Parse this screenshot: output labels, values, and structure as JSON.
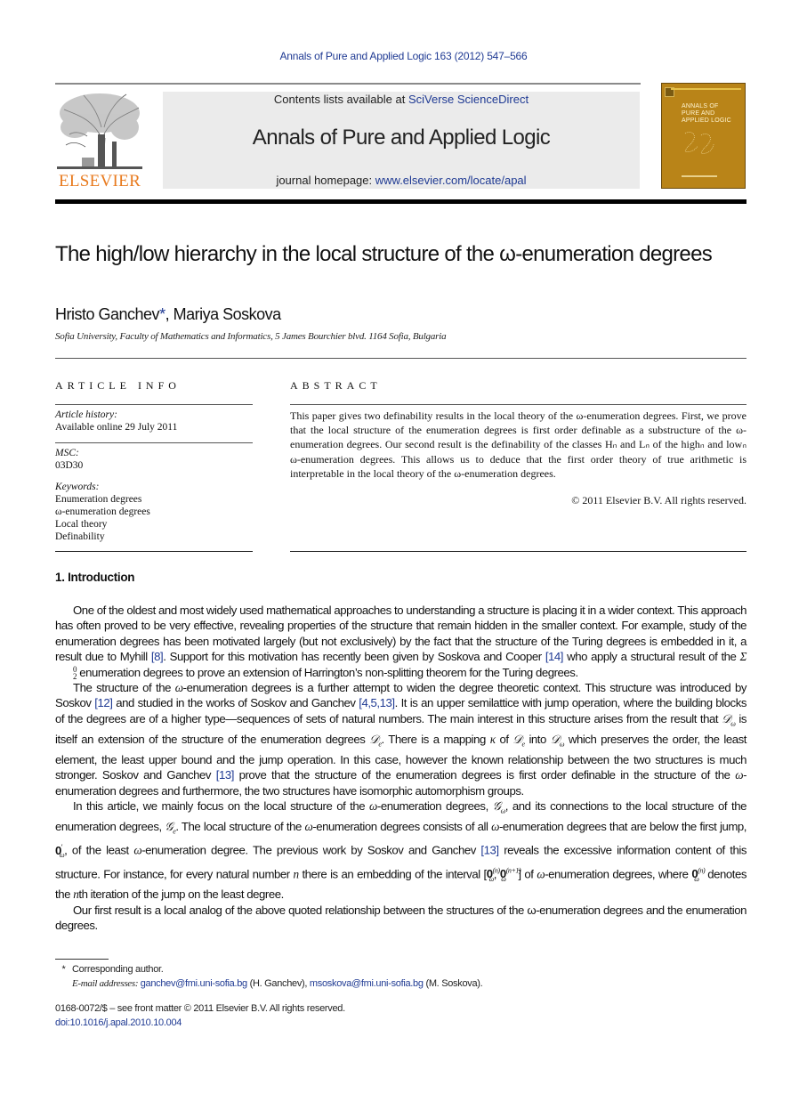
{
  "header": {
    "journal_ref": "Annals of Pure and Applied Logic 163 (2012) 547–566",
    "contents_prefix": "Contents lists available at ",
    "contents_link": "SciVerse ScienceDirect",
    "journal_title": "Annals of Pure and Applied Logic",
    "homepage_prefix": "journal homepage: ",
    "homepage_link": "www.elsevier.com/locate/apal",
    "publisher_logo": "ELSEVIER",
    "cover_title_lines": [
      "ANNALS OF",
      "PURE AND",
      "APPLIED LOGIC"
    ]
  },
  "article": {
    "title": "The high/low hierarchy in the local structure of the ω-enumeration degrees",
    "authors": [
      {
        "name": "Hristo Ganchev",
        "mark": "*"
      },
      {
        "name": "Mariya Soskova",
        "mark": ""
      }
    ],
    "affiliation": "Sofia University, Faculty of Mathematics and Informatics, 5 James Bourchier blvd. 1164 Sofia, Bulgaria"
  },
  "article_info": {
    "heading": "ARTICLE INFO",
    "history_label": "Article history:",
    "history_value": "Available online 29 July 2011",
    "msc_label": "MSC:",
    "msc_value": "03D30",
    "keywords_label": "Keywords:",
    "keywords": [
      "Enumeration degrees",
      "ω-enumeration degrees",
      "Local theory",
      "Definability"
    ]
  },
  "abstract": {
    "heading": "ABSTRACT",
    "text": "This paper gives two definability results in the local theory of the ω-enumeration degrees. First, we prove that the local structure of the enumeration degrees is first order definable as a substructure of the ω-enumeration degrees. Our second result is the definability of the classes Hₙ and Lₙ of the highₙ and lowₙ ω-enumeration degrees. This allows us to deduce that the first order theory of true arithmetic is interpretable in the local theory of the ω-enumeration degrees.",
    "copyright": "© 2011 Elsevier B.V. All rights reserved."
  },
  "introduction": {
    "heading": "1. Introduction",
    "p1": {
      "a": "One of the oldest and most widely used mathematical approaches to understanding a structure is placing it in a wider context. This approach has often proved to be very effective, revealing properties of the structure that remain hidden in the smaller context. For example, study of the enumeration degrees has been motivated largely (but not exclusively) by the fact that the structure of the Turing degrees is embedded in it, a result due to Myhill ",
      "ref1": "[8]",
      "b": ". Support for this motivation has recently been given by Soskova and Cooper ",
      "ref2": "[14]",
      "c": " who apply a structural result of the ",
      "sigma": "Σ",
      "d": " enumeration degrees to prove an extension of Harrington’s non-splitting theorem for the Turing degrees."
    },
    "p2": {
      "a": "The structure of the ",
      "b": "-enumeration degrees is a further attempt to widen the degree theoretic context. This structure was introduced by Soskov ",
      "ref1": "[12]",
      "c": " and studied in the works of Soskov and Ganchev ",
      "ref2": "[4,5,13]",
      "d": ". It is an upper semilattice with jump operation, where the building blocks of the degrees are of a higher type—sequences of sets of natural numbers. The main interest in this structure arises from the result that ",
      "e": " is itself an extension of the structure of the enumeration degrees ",
      "f": ". There is a mapping ",
      "kappa": "κ",
      "g": " of ",
      "h": " into ",
      "i": " which preserves the order, the least element, the least upper bound and the jump operation. In this case, however the known relationship between the two structures is much stronger. Soskov and Ganchev ",
      "ref3": "[13]",
      "j": " prove that the structure of the enumeration degrees is first order definable in the structure of the ",
      "k": "-enumeration degrees and furthermore, the two structures have isomorphic automorphism groups."
    },
    "p3": {
      "a": "In this article, we mainly focus on the local structure of the ",
      "b": "-enumeration degrees, ",
      "c": ", and its connections to the local structure of the enumeration degrees, ",
      "d": ". The local structure of the ",
      "e": "-enumeration degrees consists of all ",
      "f": "-enumeration degrees that are below the first jump, ",
      "g": ", of the least ",
      "h": "-enumeration degree. The previous work by Soskov and Ganchev ",
      "ref1": "[13]",
      "i": " reveals the excessive information content of this structure. For instance, for every natural number ",
      "n": "n",
      "j": " there is an embedding of the interval [",
      "k": "] of ",
      "l": "-enumeration degrees, where ",
      "m": " denotes the ",
      "nth": "n",
      "o": "th iteration of the jump on the least degree."
    },
    "p4": "Our first result is a local analog of the above quoted relationship between the structures of the ω-enumeration degrees and the enumeration degrees.",
    "symbols": {
      "omega": "ω",
      "D_omega": "𝒟",
      "D_e": "𝒟",
      "G_omega": "𝒢",
      "G_e": "𝒢",
      "zero": "0"
    }
  },
  "footnotes": {
    "star": "*",
    "corresponding": "Corresponding author.",
    "email_label": "E-mail addresses: ",
    "email1": "ganchev@fmi.uni-sofia.bg",
    "email1_owner": " (H. Ganchev), ",
    "email2": "msoskova@fmi.uni-sofia.bg",
    "email2_owner": " (M. Soskova).",
    "front_matter": "0168-0072/$ – see front matter © 2011 Elsevier B.V. All rights reserved.",
    "doi": "doi:10.1016/j.apal.2010.10.004"
  },
  "colors": {
    "link": "#1f3a93",
    "elsevier_orange": "#e87a1e",
    "cover_gold": "#b98418",
    "banner_gray": "#ebebeb"
  }
}
